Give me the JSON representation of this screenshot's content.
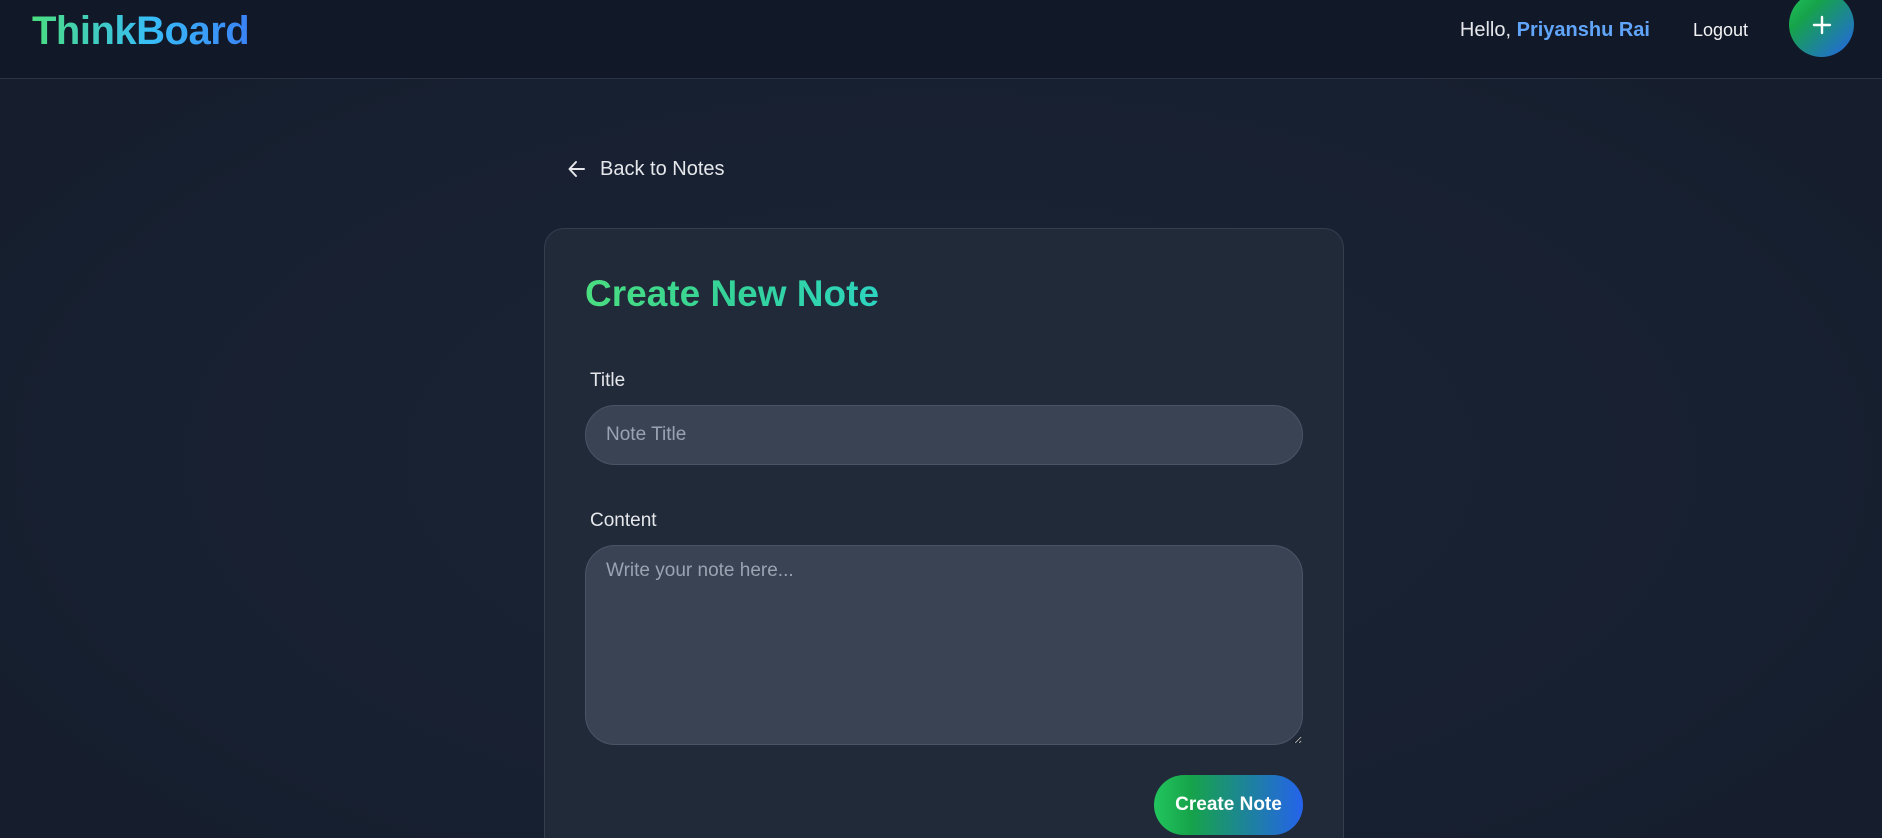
{
  "header": {
    "logo": "ThinkBoard",
    "greeting_prefix": "Hello,",
    "user_name": "Priyanshu Rai",
    "logout_label": "Logout",
    "add_icon": "plus-icon"
  },
  "nav": {
    "back_label": "Back to Notes",
    "back_icon": "arrow-left-icon"
  },
  "form": {
    "heading": "Create New Note",
    "title_label": "Title",
    "title_placeholder": "Note Title",
    "title_value": "",
    "content_label": "Content",
    "content_placeholder": "Write your note here...",
    "content_value": "",
    "submit_label": "Create Note"
  },
  "colors": {
    "background": "#172030",
    "header_bg": "#111827",
    "card_bg": "#212a39",
    "input_bg": "#394354",
    "accent_green": "#22c55e",
    "accent_blue": "#2563eb",
    "user_name": "#60a5fa"
  }
}
